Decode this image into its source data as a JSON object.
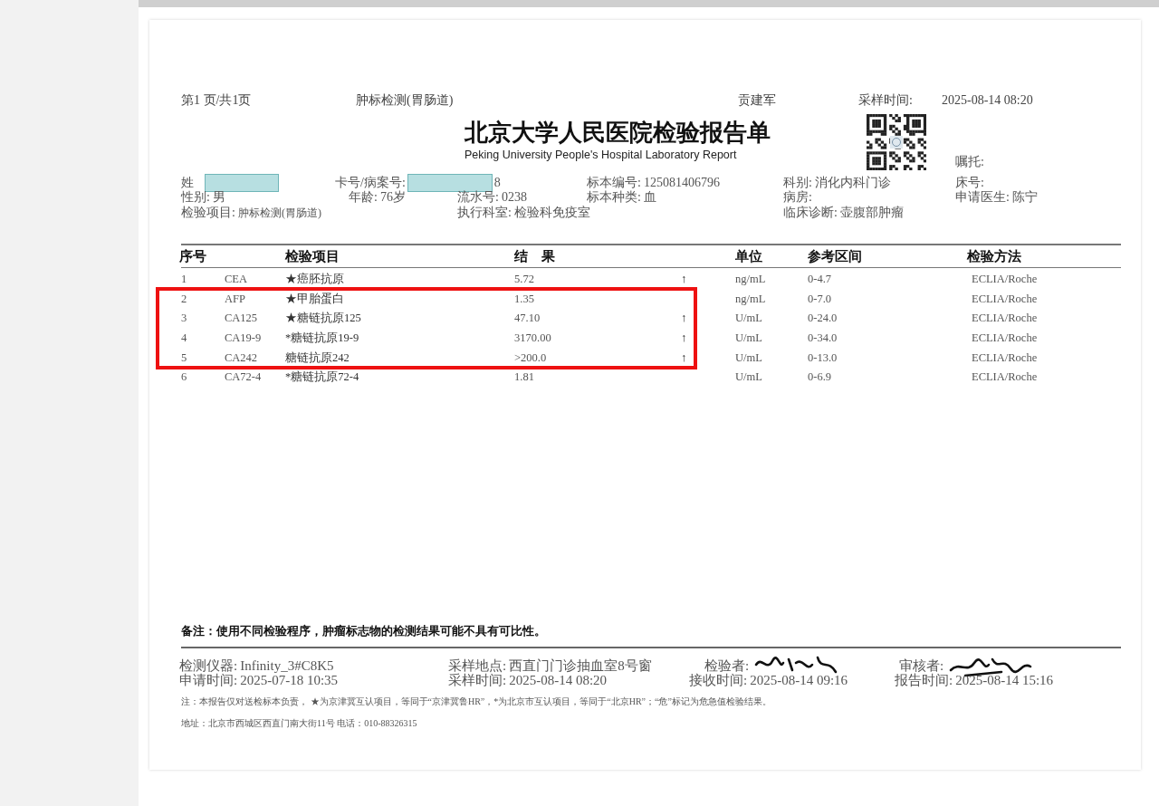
{
  "report": {
    "top_line": [
      "第1 页/共1页",
      "肿标检测(胃肠道)",
      "贡建军",
      "采样时间:",
      "2025-08-14 08:20"
    ],
    "title": "北京大学人民医院检验报告单",
    "subtitle": "Peking University People's Hospital Laboratory Report",
    "entrust": "嘱托:",
    "info_rows": [
      [
        {
          "label": "姓",
          "redacted": true
        },
        {
          "label": "卡号/病案号:",
          "value": "8",
          "redacted": true
        },
        {
          "label": "标本编号:",
          "value": "125081406796"
        },
        {
          "label": "科别:",
          "value": "消化内科门诊"
        },
        {
          "label": "床号:"
        }
      ],
      [
        {
          "label": "性别:",
          "value": "男"
        },
        {
          "label": "年龄:",
          "value": "76岁"
        },
        {
          "label": "流水号:",
          "value": "0238"
        },
        {
          "label": "标本种类:",
          "value": "血"
        },
        {
          "label": "病房:"
        },
        {
          "label": "申请医生:",
          "value": "陈宁"
        }
      ],
      [
        {
          "label": "检验项目:",
          "value": "肿标检测(胃肠道)"
        },
        {
          "label": "执行科室:",
          "value": "检验科免疫室"
        },
        {
          "label": "临床诊断:",
          "value": "壶腹部肿瘤"
        }
      ]
    ],
    "table": {
      "columns": [
        "序号",
        "检验项目",
        "结　果",
        "单位",
        "参考区间",
        "检验方法"
      ],
      "rows": [
        {
          "no": "1",
          "code": "CEA",
          "name": "★癌胚抗原",
          "result": "5.72",
          "flag": "↑",
          "unit": "ng/mL",
          "range": "0-4.7",
          "method": "ECLIA/Roche"
        },
        {
          "no": "2",
          "code": "AFP",
          "name": "★甲胎蛋白",
          "result": "1.35",
          "unit": "ng/mL",
          "range": "0-7.0",
          "method": "ECLIA/Roche"
        },
        {
          "no": "3",
          "code": "CA125",
          "name": "★糖链抗原125",
          "result": "47.10",
          "flag": "↑",
          "unit": "U/mL",
          "range": "0-24.0",
          "method": "ECLIA/Roche"
        },
        {
          "no": "4",
          "code": "CA19-9",
          "name": "*糖链抗原19-9",
          "result": "3170.00",
          "flag": "↑",
          "unit": "U/mL",
          "range": "0-34.0",
          "method": "ECLIA/Roche"
        },
        {
          "no": "5",
          "code": "CA242",
          "name": "糖链抗原242",
          "result": ">200.0",
          "flag": "↑",
          "unit": "U/mL",
          "range": "0-13.0",
          "method": "ECLIA/Roche"
        },
        {
          "no": "6",
          "code": "CA72-4",
          "name": "*糖链抗原72-4",
          "result": "1.81",
          "unit": "U/mL",
          "range": "0-6.9",
          "method": "ECLIA/Roche"
        }
      ]
    },
    "remark": "备注：使用不同检验程序，肿瘤标志物的检测结果可能不具有可比性。",
    "footer_rows": [
      [
        {
          "label": "检测仪器:",
          "value": "Infinity_3#C8K5"
        },
        {
          "label": "采样地点:",
          "value": "西直门门诊抽血室8号窗"
        },
        {
          "label": "检验者:",
          "kind": "signature"
        },
        {
          "label": "审核者:",
          "kind": "signature"
        }
      ],
      [
        {
          "label": "申请时间:",
          "value": "2025-07-18 10:35"
        },
        {
          "label": "采样时间:",
          "value": "2025-08-14 08:20"
        },
        {
          "label": "接收时间:",
          "value": "2025-08-14 09:16"
        },
        {
          "label": "报告时间:",
          "value": "2025-08-14 15:16"
        }
      ]
    ],
    "note": "注：本报告仅对送检标本负责， ★为京津冀互认项目，等同于“京津冀鲁HR”，*为北京市互认项目，等同于“北京HR”；“危”标记为危急值检验结果。",
    "address": "地址：北京市西城区西直门南大街11号 电话：010-88326315"
  }
}
